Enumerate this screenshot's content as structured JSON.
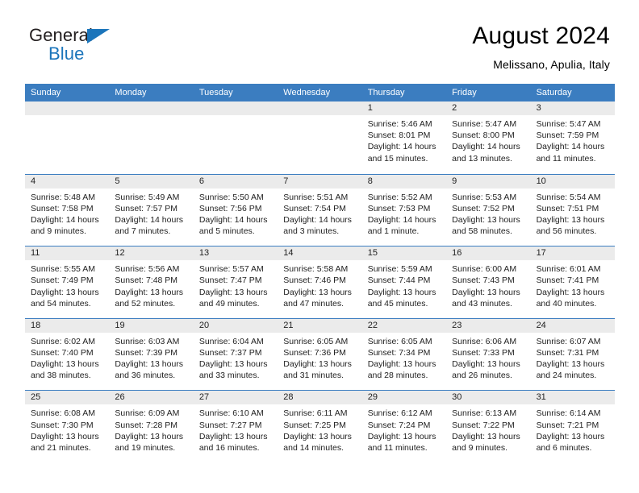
{
  "brand": {
    "name_part1": "General",
    "name_part2": "Blue",
    "flag_icon": "triangle-flag-icon"
  },
  "header": {
    "title": "August 2024",
    "location": "Melissano, Apulia, Italy"
  },
  "colors": {
    "header_blue": "#3b7dc0",
    "brand_blue": "#1b75bb",
    "day_head_gray": "#ebebeb"
  },
  "weekdays": [
    "Sunday",
    "Monday",
    "Tuesday",
    "Wednesday",
    "Thursday",
    "Friday",
    "Saturday"
  ],
  "weeks": [
    [
      {
        "day": "",
        "lines": []
      },
      {
        "day": "",
        "lines": []
      },
      {
        "day": "",
        "lines": []
      },
      {
        "day": "",
        "lines": []
      },
      {
        "day": "1",
        "lines": [
          "Sunrise: 5:46 AM",
          "Sunset: 8:01 PM",
          "Daylight: 14 hours",
          "and 15 minutes."
        ]
      },
      {
        "day": "2",
        "lines": [
          "Sunrise: 5:47 AM",
          "Sunset: 8:00 PM",
          "Daylight: 14 hours",
          "and 13 minutes."
        ]
      },
      {
        "day": "3",
        "lines": [
          "Sunrise: 5:47 AM",
          "Sunset: 7:59 PM",
          "Daylight: 14 hours",
          "and 11 minutes."
        ]
      }
    ],
    [
      {
        "day": "4",
        "lines": [
          "Sunrise: 5:48 AM",
          "Sunset: 7:58 PM",
          "Daylight: 14 hours",
          "and 9 minutes."
        ]
      },
      {
        "day": "5",
        "lines": [
          "Sunrise: 5:49 AM",
          "Sunset: 7:57 PM",
          "Daylight: 14 hours",
          "and 7 minutes."
        ]
      },
      {
        "day": "6",
        "lines": [
          "Sunrise: 5:50 AM",
          "Sunset: 7:56 PM",
          "Daylight: 14 hours",
          "and 5 minutes."
        ]
      },
      {
        "day": "7",
        "lines": [
          "Sunrise: 5:51 AM",
          "Sunset: 7:54 PM",
          "Daylight: 14 hours",
          "and 3 minutes."
        ]
      },
      {
        "day": "8",
        "lines": [
          "Sunrise: 5:52 AM",
          "Sunset: 7:53 PM",
          "Daylight: 14 hours",
          "and 1 minute."
        ]
      },
      {
        "day": "9",
        "lines": [
          "Sunrise: 5:53 AM",
          "Sunset: 7:52 PM",
          "Daylight: 13 hours",
          "and 58 minutes."
        ]
      },
      {
        "day": "10",
        "lines": [
          "Sunrise: 5:54 AM",
          "Sunset: 7:51 PM",
          "Daylight: 13 hours",
          "and 56 minutes."
        ]
      }
    ],
    [
      {
        "day": "11",
        "lines": [
          "Sunrise: 5:55 AM",
          "Sunset: 7:49 PM",
          "Daylight: 13 hours",
          "and 54 minutes."
        ]
      },
      {
        "day": "12",
        "lines": [
          "Sunrise: 5:56 AM",
          "Sunset: 7:48 PM",
          "Daylight: 13 hours",
          "and 52 minutes."
        ]
      },
      {
        "day": "13",
        "lines": [
          "Sunrise: 5:57 AM",
          "Sunset: 7:47 PM",
          "Daylight: 13 hours",
          "and 49 minutes."
        ]
      },
      {
        "day": "14",
        "lines": [
          "Sunrise: 5:58 AM",
          "Sunset: 7:46 PM",
          "Daylight: 13 hours",
          "and 47 minutes."
        ]
      },
      {
        "day": "15",
        "lines": [
          "Sunrise: 5:59 AM",
          "Sunset: 7:44 PM",
          "Daylight: 13 hours",
          "and 45 minutes."
        ]
      },
      {
        "day": "16",
        "lines": [
          "Sunrise: 6:00 AM",
          "Sunset: 7:43 PM",
          "Daylight: 13 hours",
          "and 43 minutes."
        ]
      },
      {
        "day": "17",
        "lines": [
          "Sunrise: 6:01 AM",
          "Sunset: 7:41 PM",
          "Daylight: 13 hours",
          "and 40 minutes."
        ]
      }
    ],
    [
      {
        "day": "18",
        "lines": [
          "Sunrise: 6:02 AM",
          "Sunset: 7:40 PM",
          "Daylight: 13 hours",
          "and 38 minutes."
        ]
      },
      {
        "day": "19",
        "lines": [
          "Sunrise: 6:03 AM",
          "Sunset: 7:39 PM",
          "Daylight: 13 hours",
          "and 36 minutes."
        ]
      },
      {
        "day": "20",
        "lines": [
          "Sunrise: 6:04 AM",
          "Sunset: 7:37 PM",
          "Daylight: 13 hours",
          "and 33 minutes."
        ]
      },
      {
        "day": "21",
        "lines": [
          "Sunrise: 6:05 AM",
          "Sunset: 7:36 PM",
          "Daylight: 13 hours",
          "and 31 minutes."
        ]
      },
      {
        "day": "22",
        "lines": [
          "Sunrise: 6:05 AM",
          "Sunset: 7:34 PM",
          "Daylight: 13 hours",
          "and 28 minutes."
        ]
      },
      {
        "day": "23",
        "lines": [
          "Sunrise: 6:06 AM",
          "Sunset: 7:33 PM",
          "Daylight: 13 hours",
          "and 26 minutes."
        ]
      },
      {
        "day": "24",
        "lines": [
          "Sunrise: 6:07 AM",
          "Sunset: 7:31 PM",
          "Daylight: 13 hours",
          "and 24 minutes."
        ]
      }
    ],
    [
      {
        "day": "25",
        "lines": [
          "Sunrise: 6:08 AM",
          "Sunset: 7:30 PM",
          "Daylight: 13 hours",
          "and 21 minutes."
        ]
      },
      {
        "day": "26",
        "lines": [
          "Sunrise: 6:09 AM",
          "Sunset: 7:28 PM",
          "Daylight: 13 hours",
          "and 19 minutes."
        ]
      },
      {
        "day": "27",
        "lines": [
          "Sunrise: 6:10 AM",
          "Sunset: 7:27 PM",
          "Daylight: 13 hours",
          "and 16 minutes."
        ]
      },
      {
        "day": "28",
        "lines": [
          "Sunrise: 6:11 AM",
          "Sunset: 7:25 PM",
          "Daylight: 13 hours",
          "and 14 minutes."
        ]
      },
      {
        "day": "29",
        "lines": [
          "Sunrise: 6:12 AM",
          "Sunset: 7:24 PM",
          "Daylight: 13 hours",
          "and 11 minutes."
        ]
      },
      {
        "day": "30",
        "lines": [
          "Sunrise: 6:13 AM",
          "Sunset: 7:22 PM",
          "Daylight: 13 hours",
          "and 9 minutes."
        ]
      },
      {
        "day": "31",
        "lines": [
          "Sunrise: 6:14 AM",
          "Sunset: 7:21 PM",
          "Daylight: 13 hours",
          "and 6 minutes."
        ]
      }
    ]
  ]
}
